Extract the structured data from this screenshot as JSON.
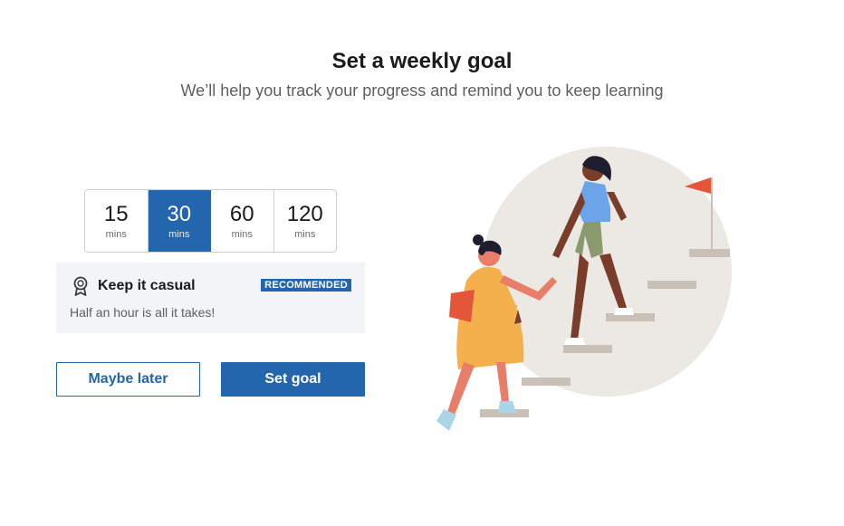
{
  "header": {
    "title": "Set a weekly goal",
    "subtitle": "We’ll help you track your progress and remind you to keep learning"
  },
  "options": [
    {
      "value": "15",
      "unit": "mins",
      "selected": false
    },
    {
      "value": "30",
      "unit": "mins",
      "selected": true
    },
    {
      "value": "60",
      "unit": "mins",
      "selected": false
    },
    {
      "value": "120",
      "unit": "mins",
      "selected": false
    }
  ],
  "info": {
    "icon": "award-ribbon-icon",
    "heading": "Keep it casual",
    "badge": "RECOMMENDED",
    "description": "Half an hour is all it takes!"
  },
  "buttons": {
    "maybe_later": "Maybe later",
    "set_goal": "Set goal"
  },
  "colors": {
    "accent": "#2466ad",
    "panel": "#f2f4f7"
  }
}
